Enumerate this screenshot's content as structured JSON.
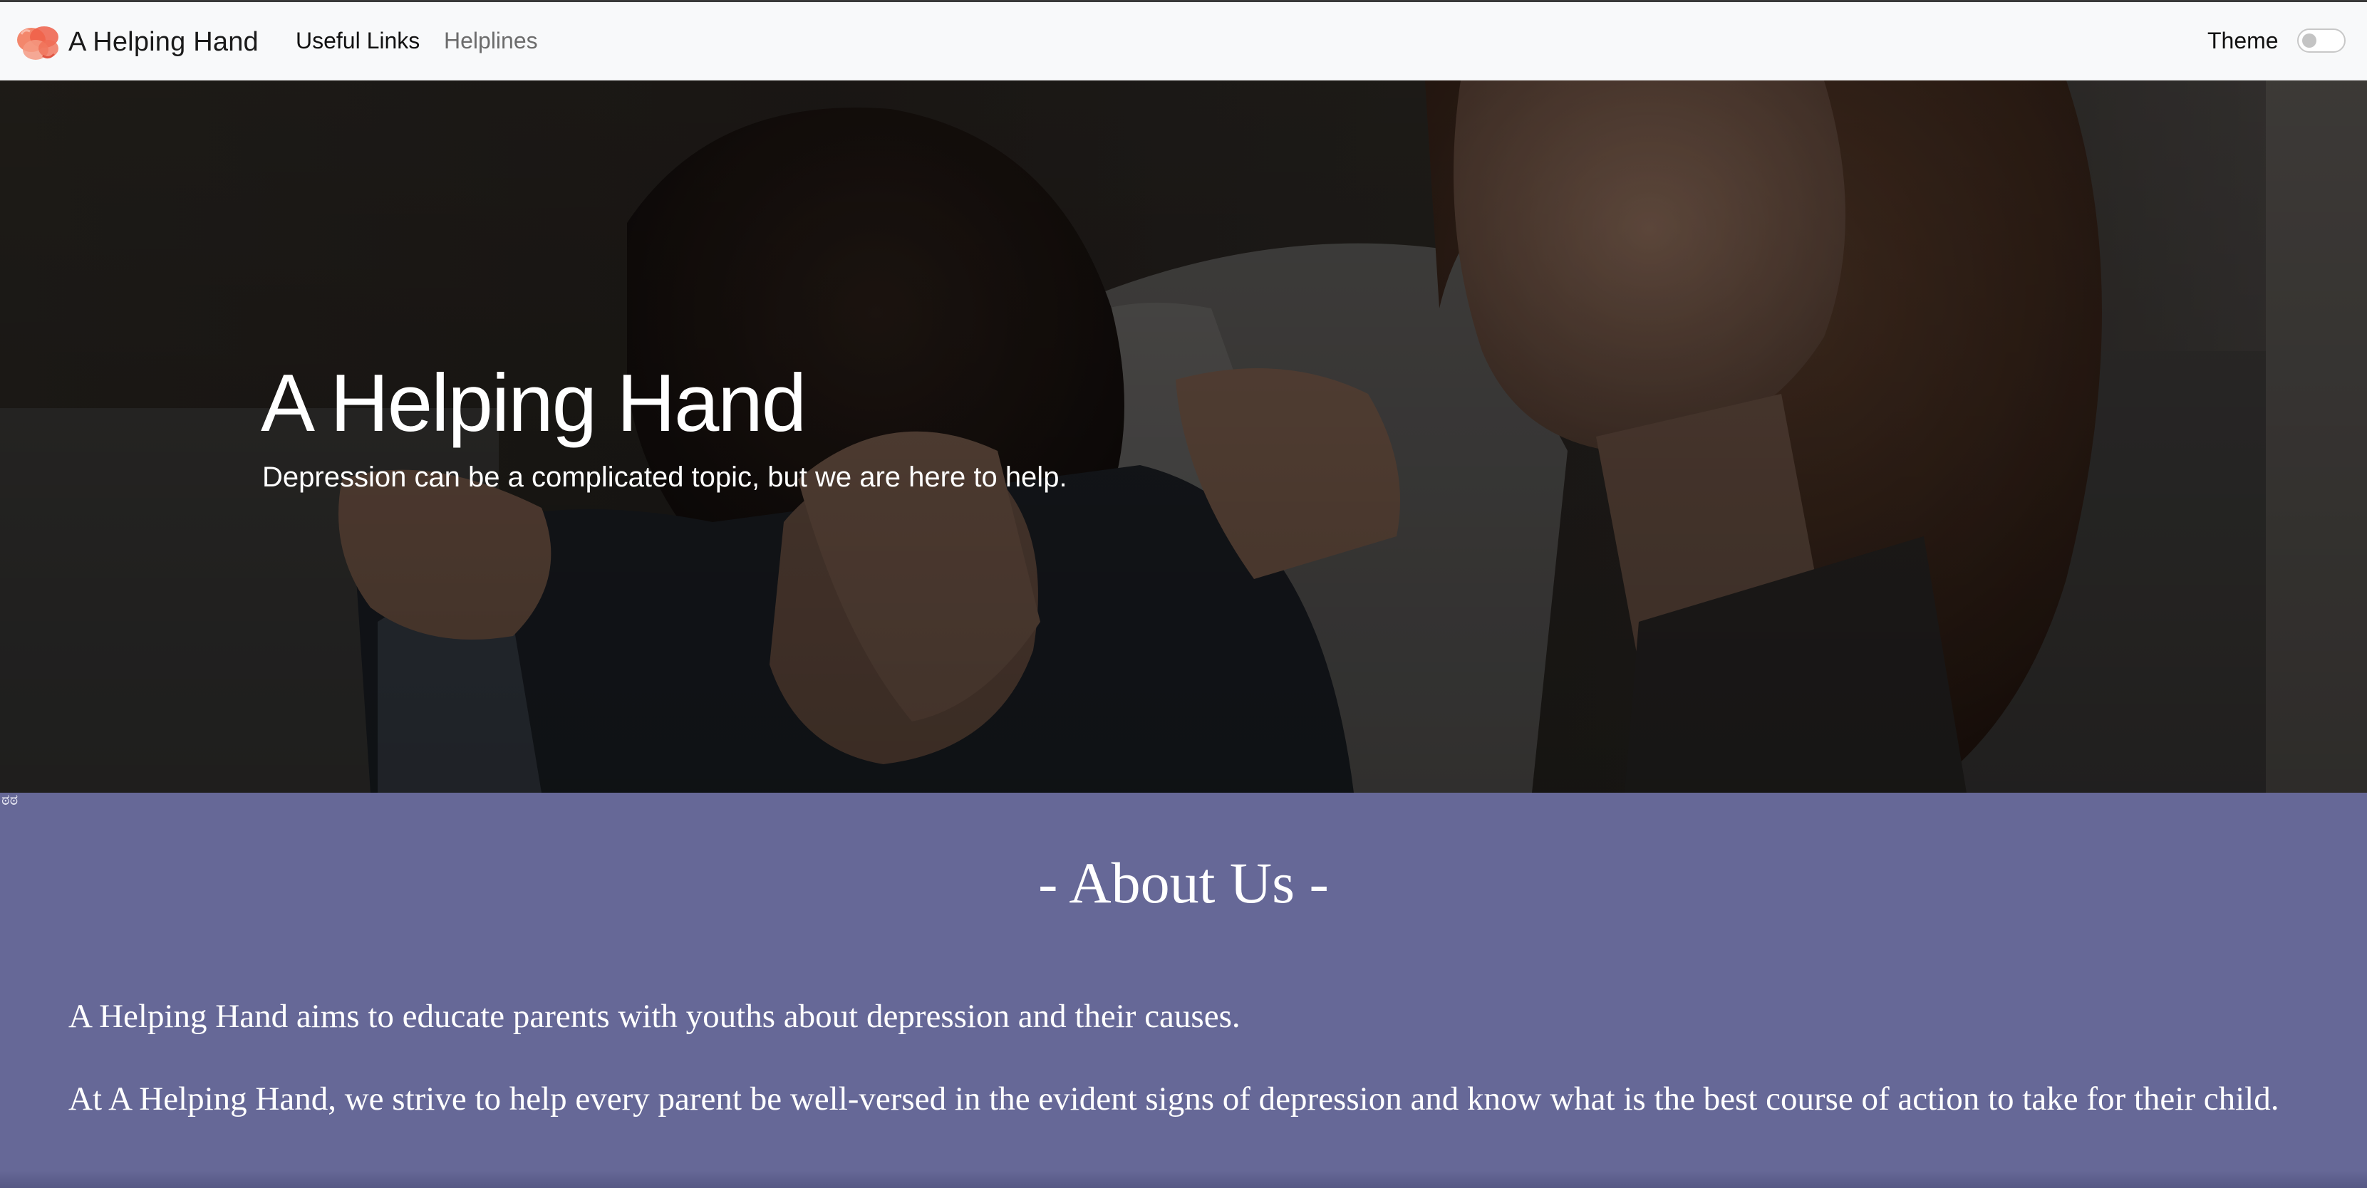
{
  "navbar": {
    "brand_name": "A Helping Hand",
    "links": [
      {
        "label": "Useful Links",
        "color": "#111111"
      },
      {
        "label": "Helplines",
        "color": "#6c6c6c"
      }
    ],
    "theme_label": "Theme",
    "theme_toggle_on": false
  },
  "hero": {
    "title": "A Helping Hand",
    "subtitle": "Depression can be a complicated topic, but we are here to help."
  },
  "about": {
    "anchor_glyph": "ಠಠ",
    "title": "- About Us -",
    "paragraphs": [
      "A Helping Hand aims to educate parents with youths about depression and their causes.",
      "At A Helping Hand, we strive to help every parent be well-versed in the evident signs of depression and know what is the best course of action to take for their child."
    ],
    "background_color": "#666897"
  },
  "icons": {
    "brand_logo": "helping-hand-logo-icon",
    "theme_toggle": "toggle-switch-icon"
  }
}
